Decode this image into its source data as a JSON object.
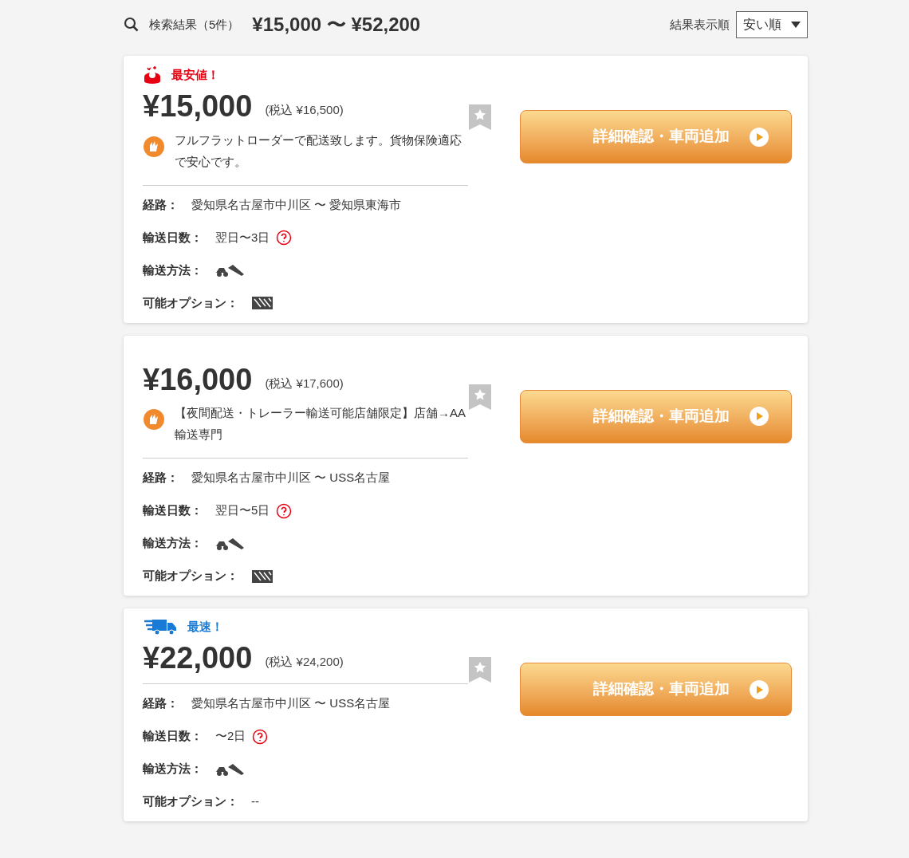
{
  "summary": {
    "label": "検索結果（5件）",
    "range": "¥15,000 〜 ¥52,200"
  },
  "sort": {
    "label": "結果表示順",
    "value": "安い順"
  },
  "results": [
    {
      "badge": {
        "kind": "cheapest",
        "text": "最安値！"
      },
      "price": "¥15,000",
      "tax": "(税込 ¥16,500)",
      "bookmarked": false,
      "comment": "フルフラットローダーで配送致します。貨物保険適応で安心です。",
      "rows": [
        {
          "kind": "text",
          "label": "経路：",
          "value": "愛知県名古屋市中川区 〜 愛知県東海市"
        },
        {
          "kind": "days",
          "label": "輸送日数：",
          "value": "翌日〜3日"
        },
        {
          "kind": "method",
          "label": "輸送方法："
        },
        {
          "kind": "option",
          "label": "可能オプション："
        }
      ],
      "button": "詳細確認・車両追加"
    },
    {
      "price": "¥16,000",
      "tax": "(税込 ¥17,600)",
      "bookmarked": false,
      "comment": "【夜間配送・トレーラー輸送可能店舗限定】店舗→AA輸送専門",
      "rows": [
        {
          "kind": "text",
          "label": "経路：",
          "value": "愛知県名古屋市中川区 〜 USS名古屋"
        },
        {
          "kind": "days",
          "label": "輸送日数：",
          "value": "翌日〜5日"
        },
        {
          "kind": "method",
          "label": "輸送方法："
        },
        {
          "kind": "option",
          "label": "可能オプション："
        }
      ],
      "button": "詳細確認・車両追加"
    },
    {
      "badge": {
        "kind": "fastest",
        "text": "最速！"
      },
      "price": "¥22,000",
      "tax": "(税込 ¥24,200)",
      "bookmarked": false,
      "rows": [
        {
          "kind": "text",
          "label": "経路：",
          "value": "愛知県名古屋市中川区 〜 USS名古屋"
        },
        {
          "kind": "days",
          "label": "輸送日数：",
          "value": "〜2日"
        },
        {
          "kind": "method",
          "label": "輸送方法："
        },
        {
          "kind": "text",
          "label": "可能オプション：",
          "value": "--"
        }
      ],
      "button": "詳細確認・車両追加"
    }
  ]
}
